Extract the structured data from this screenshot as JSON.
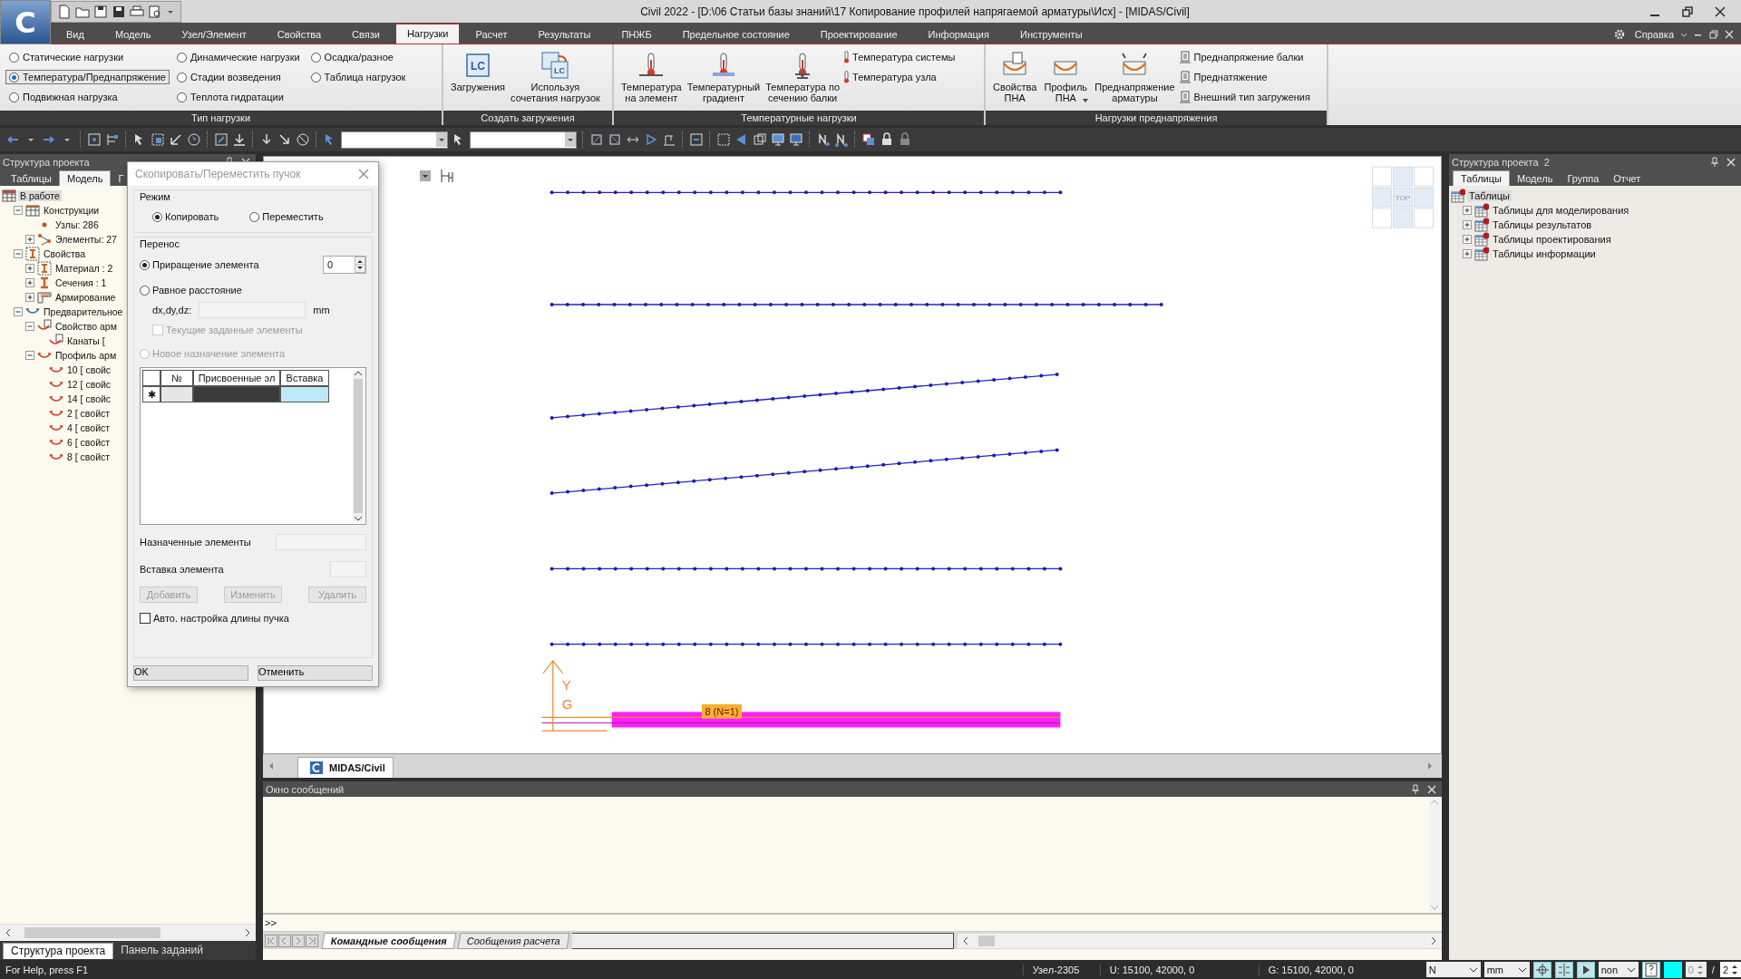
{
  "window": {
    "logo_text": "C",
    "title": "Civil 2022 - [D:\\06 Статьи базы знаний\\17 Копирование профилей напрягаемой арматуры\\Исх] - [MIDAS/Civil]"
  },
  "menu_tabs": [
    {
      "label": "Вид",
      "selected": false
    },
    {
      "label": "Модель",
      "selected": false
    },
    {
      "label": "Узел/Элемент",
      "selected": false
    },
    {
      "label": "Свойства",
      "selected": false
    },
    {
      "label": "Связи",
      "selected": false
    },
    {
      "label": "Нагрузки",
      "selected": true
    },
    {
      "label": "Расчет",
      "selected": false
    },
    {
      "label": "Результаты",
      "selected": false
    },
    {
      "label": "ПНЖБ",
      "selected": false
    },
    {
      "label": "Предельное состояние",
      "selected": false
    },
    {
      "label": "Проектирование",
      "selected": false
    },
    {
      "label": "Информация",
      "selected": false
    },
    {
      "label": "Инструменты",
      "selected": false
    }
  ],
  "help_menu": "Справка",
  "ribbon_groups": [
    {
      "title": "Тип нагрузки",
      "items": [
        {
          "kind": "radio",
          "label": "Статические нагрузки",
          "selected": false
        },
        {
          "kind": "radio",
          "label": "Температура/Преднапряжение",
          "selected": true
        },
        {
          "kind": "radio",
          "label": "Подвижная нагрузка",
          "selected": false
        },
        {
          "kind": "radio",
          "label": "Динамические нагрузки",
          "selected": false
        },
        {
          "kind": "radio",
          "label": "Стадии возведения",
          "selected": false
        },
        {
          "kind": "radio",
          "label": "Теплота гидратации",
          "selected": false
        },
        {
          "kind": "radio",
          "label": "Осадка/разное",
          "selected": false
        },
        {
          "kind": "radio",
          "label": "Таблица нагрузок",
          "selected": false
        }
      ]
    },
    {
      "title": "Создать загружения",
      "items": [
        {
          "kind": "large",
          "label": "Загружения",
          "icon_text": "LC",
          "dropdown": false
        },
        {
          "kind": "large",
          "label": "Используя\nсочетания нагрузок",
          "icon_text": "LC",
          "dropdown": false
        }
      ]
    },
    {
      "title": "Температурные нагрузки",
      "items": [
        {
          "kind": "large",
          "label": "Температура\nна элемент",
          "dropdown": false
        },
        {
          "kind": "large",
          "label": "Температурный\nградиент",
          "dropdown": false
        },
        {
          "kind": "large",
          "label": "Температура по\nсечению балки",
          "dropdown": false
        },
        {
          "kind": "small",
          "label": "Температура системы"
        },
        {
          "kind": "small",
          "label": "Температура узла"
        }
      ]
    },
    {
      "title": "Нагрузки преднапряжения",
      "items": [
        {
          "kind": "large",
          "label": "Свойства\nПНА",
          "dropdown": false
        },
        {
          "kind": "large",
          "label": "Профиль\nПНА",
          "dropdown": true
        },
        {
          "kind": "large",
          "label": "Преднапряжение\nарматуры",
          "dropdown": false
        },
        {
          "kind": "small",
          "label": "Преднапряжение балки"
        },
        {
          "kind": "small",
          "label": "Преднатяжение"
        },
        {
          "kind": "small",
          "label": "Внешний тип загружения"
        }
      ]
    }
  ],
  "left_panel": {
    "title": "Структура проекта",
    "tabs": [
      {
        "label": "Таблицы",
        "selected": false
      },
      {
        "label": "Модель",
        "selected": true
      },
      {
        "label": "Г",
        "selected": false
      }
    ],
    "tree": [
      {
        "label": "В работе",
        "kind": "work",
        "selected": true,
        "children": [
          {
            "label": "Конструкции",
            "kind": "structure",
            "selected": false,
            "expanded": true,
            "children": [
              {
                "label": "Узлы: 286",
                "kind": "nodes",
                "selected": false
              },
              {
                "label": "Элементы: 27",
                "kind": "elements",
                "selected": false,
                "expanded": false
              }
            ]
          },
          {
            "label": "Свойства",
            "kind": "properties",
            "selected": false,
            "expanded": true,
            "children": [
              {
                "label": "Материал : 2",
                "kind": "material",
                "selected": false,
                "expanded": false
              },
              {
                "label": "Сечения : 1",
                "kind": "section",
                "selected": false,
                "expanded": false
              },
              {
                "label": "Армирование",
                "kind": "reinforcement",
                "selected": false,
                "expanded": false
              }
            ]
          },
          {
            "label": "Предварительное",
            "kind": "prestress",
            "selected": false,
            "expanded": true,
            "children": [
              {
                "label": "Свойство арм",
                "kind": "tendon_property",
                "selected": false,
                "expanded": true,
                "children": [
                  {
                    "label": "Канаты [",
                    "kind": "tendon",
                    "selected": false
                  }
                ]
              },
              {
                "label": "Профиль арм",
                "kind": "profile_group",
                "selected": false,
                "expanded": true,
                "children": [
                  {
                    "label": "10 [ свойс",
                    "kind": "profile",
                    "selected": false
                  },
                  {
                    "label": "12 [ свойс",
                    "kind": "profile",
                    "selected": false
                  },
                  {
                    "label": "14 [ свойс",
                    "kind": "profile",
                    "selected": false
                  },
                  {
                    "label": "2 [ свойст",
                    "kind": "profile",
                    "selected": false
                  },
                  {
                    "label": "4 [ свойст",
                    "kind": "profile",
                    "selected": false
                  },
                  {
                    "label": "6 [ свойст",
                    "kind": "profile",
                    "selected": false
                  },
                  {
                    "label": "8 [ свойст",
                    "kind": "profile",
                    "selected": false
                  }
                ]
              }
            ]
          }
        ]
      }
    ],
    "bottom_tabs": [
      {
        "label": "Структура проекта",
        "selected": true
      },
      {
        "label": "Панель заданий",
        "selected": false
      }
    ]
  },
  "dialog": {
    "title": "Скопировать/Переместить пучок",
    "mode_title": "Режим",
    "mode_options": [
      {
        "label": "Копировать",
        "selected": true
      },
      {
        "label": "Переместить",
        "selected": false
      }
    ],
    "transfer_title": "Перенос",
    "increment": {
      "label": "Приращение элемента",
      "selected": true,
      "value": "0"
    },
    "equal": {
      "label": "Равное расстояние",
      "selected": false
    },
    "offset_label": "dx,dy,dz:",
    "offset_unit": "mm",
    "current_elements": {
      "label": "Текущие заданные элементы",
      "checked": false,
      "disabled": true
    },
    "new_assignment": {
      "label": "Новое назначение элемента",
      "selected": false,
      "disabled": true
    },
    "table": {
      "columns": [
        "№",
        "Присвоенные эл",
        "Вставка"
      ],
      "new_row_marker": "✱"
    },
    "assigned_label": "Назначенные элементы",
    "insert_label": "Вставка элемента",
    "row_buttons": [
      {
        "label": "Добавить",
        "disabled": true
      },
      {
        "label": "Изменить",
        "disabled": true
      },
      {
        "label": "Удалить",
        "disabled": true
      }
    ],
    "auto_length": {
      "label": "Авто. настройка длины пучка",
      "checked": false
    },
    "buttons": [
      "OK",
      "Отменить"
    ]
  },
  "canvas": {
    "axis_labels": [
      "Y",
      "G"
    ],
    "member_label": "8 (N=1)",
    "view_cube_label": "TOP",
    "doc_tabs": [
      {
        "label": "MIDAS/Civil",
        "selected": true
      }
    ]
  },
  "right_panel": {
    "title": "Структура проекта  2",
    "tabs": [
      {
        "label": "Таблицы",
        "selected": true
      },
      {
        "label": "Модель",
        "selected": false
      },
      {
        "label": "Группа",
        "selected": false
      },
      {
        "label": "Отчет",
        "selected": false
      }
    ],
    "tree": [
      {
        "label": "Таблицы",
        "kind": "table",
        "selected": true,
        "children": [
          {
            "label": "Таблицы для моделирования",
            "kind": "table",
            "selected": false,
            "expanded": false
          },
          {
            "label": "Таблицы результатов",
            "kind": "table",
            "selected": false,
            "expanded": false
          },
          {
            "label": "Таблицы проектирования",
            "kind": "table",
            "selected": false,
            "expanded": false
          },
          {
            "label": "Таблицы информации",
            "kind": "table",
            "selected": false,
            "expanded": false
          }
        ]
      }
    ]
  },
  "messages": {
    "title": "Окно сообщений",
    "prompt": ">>",
    "tabs": [
      {
        "label": "Командные сообщения",
        "selected": true
      },
      {
        "label": "Сообщения расчета",
        "selected": false
      }
    ]
  },
  "status_bar": {
    "help": "For Help, press F1",
    "node": "Узел-2305",
    "local": "U: 15100, 42000, 0",
    "global": "G: 15100, 42000, 0",
    "force_unit": "N",
    "length_unit": "mm",
    "filter": "non",
    "step": "0",
    "separator": "/",
    "total": "2"
  }
}
